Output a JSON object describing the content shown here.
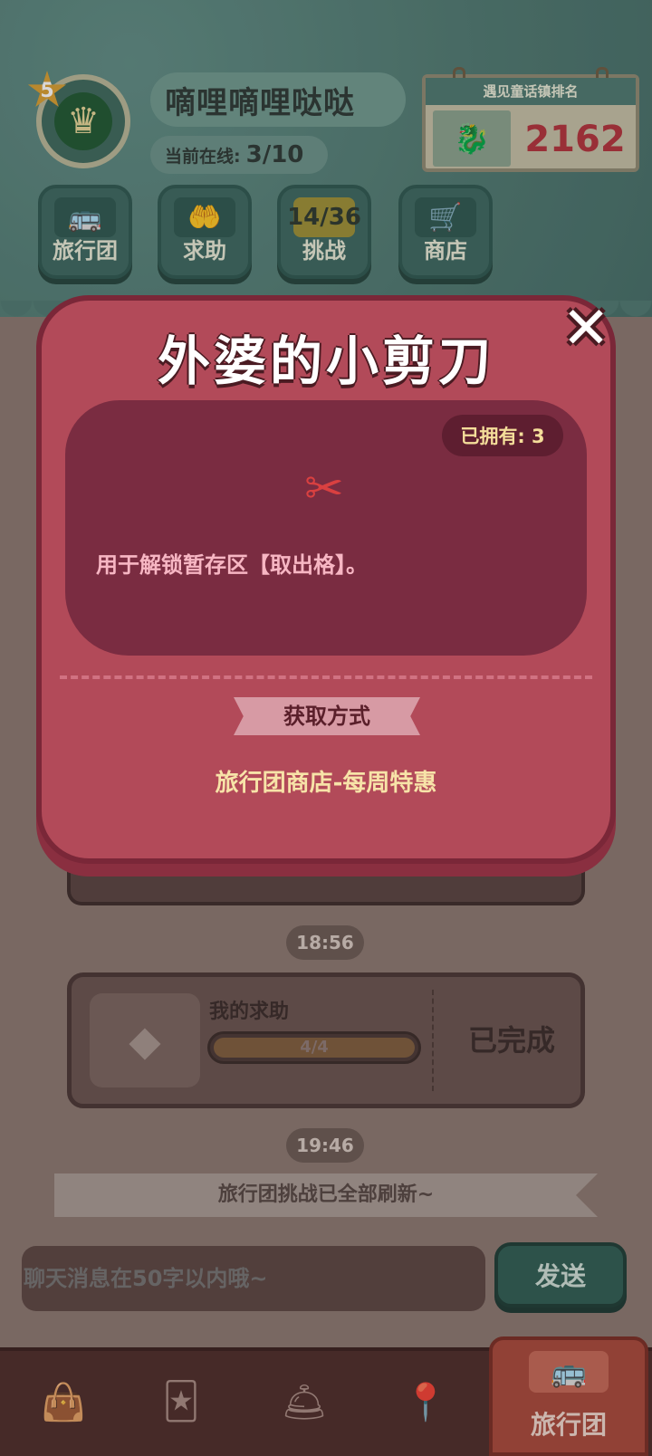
{
  "player": {
    "level": "5",
    "name": "嘀哩嘀哩哒哒",
    "online_label": "当前在线:",
    "online_value": "3/10"
  },
  "rank": {
    "title": "遇见童话镇排名",
    "value": "2162"
  },
  "nav": {
    "items": [
      {
        "label": "旅行团",
        "icon": "bus-icon"
      },
      {
        "label": "求助",
        "icon": "hand-icon"
      },
      {
        "label": "挑战",
        "badge": "14/36"
      },
      {
        "label": "商店",
        "icon": "cart-icon"
      }
    ]
  },
  "modal": {
    "title": "外婆的小剪刀",
    "owned": "已拥有: 3",
    "description": "用于解锁暂存区【取出格】。",
    "how_to_get_label": "获取方式",
    "how_to_get_value": "旅行团商店-每周特惠",
    "icon": "scissors-icon"
  },
  "chat": {
    "time1": "18:56",
    "help_card": {
      "title": "我的求助",
      "progress_text": "4/4",
      "progress": 1.0,
      "status": "已完成"
    },
    "time2": "19:46",
    "banner": "旅行团挑战已全部刷新~",
    "input_placeholder": "聊天消息在50字以内哦~",
    "send_label": "发送"
  },
  "tabs": {
    "active_label": "旅行团"
  }
}
